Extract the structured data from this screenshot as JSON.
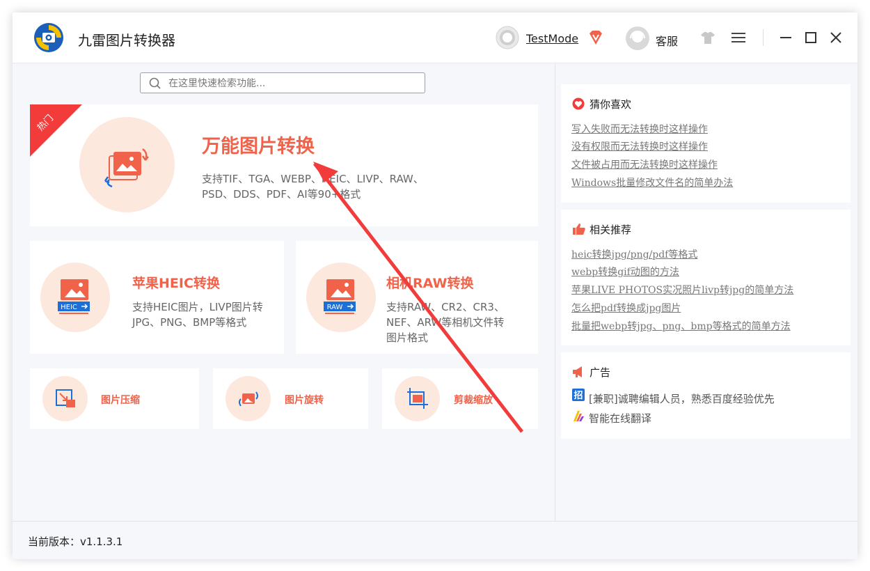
{
  "app": {
    "title": "九雷图片转换器",
    "user": "TestMode",
    "service": "客服"
  },
  "search": {
    "placeholder": "在这里快速检索功能..."
  },
  "main_card": {
    "badge": "热门",
    "title": "万能图片转换",
    "desc_line1": "支持TIF、TGA、WEBP、HEIC、LIVP、RAW、",
    "desc_line2": "PSD、DDS、PDF、AI等90+格式"
  },
  "heic_card": {
    "title": "苹果HEIC转换",
    "icon_label": "HEIC",
    "desc_line1": "支持HEIC图片，LIVP图片转",
    "desc_line2": "JPG、PNG、BMP等格式"
  },
  "raw_card": {
    "title": "相机RAW转换",
    "icon_label": "RAW",
    "desc_line1": "支持RAW、CR2、CR3、",
    "desc_line2": "NEF、ARW等相机文件转",
    "desc_line3": "图片格式"
  },
  "small_cards": [
    {
      "title": "图片压缩"
    },
    {
      "title": "图片旋转"
    },
    {
      "title": "剪裁缩放"
    }
  ],
  "sidebar": {
    "guess": {
      "title": "猜你喜欢",
      "links": [
        "写入失败而无法转换时这样操作",
        "没有权限而无法转换时这样操作",
        "文件被占用而无法转换时这样操作",
        "Windows批量修改文件名的简单办法"
      ]
    },
    "related": {
      "title": "相关推荐",
      "links": [
        "heic转换jpg/png/pdf等格式",
        "webp转换gif动图的方法",
        "苹果LIVE PHOTOS实况照片livp转jpg的简单方法",
        "怎么把pdf转换成jpg图片",
        "批量把webp转jpg、png、bmp等格式的简单方法"
      ]
    },
    "ads": {
      "title": "广告",
      "items": [
        "[兼职]诚聘编辑人员，熟悉百度经验优先",
        "智能在线翻译"
      ]
    }
  },
  "footer": {
    "version": "当前版本：v1.1.3.1"
  },
  "colors": {
    "accent": "#f0624a",
    "badge": "#f23b3b",
    "icon_bg": "#fde8de",
    "arrow": "#f23b3b"
  }
}
